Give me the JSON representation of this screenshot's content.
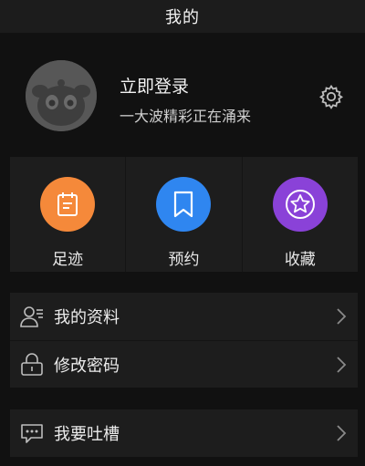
{
  "header": {
    "title": "我的"
  },
  "profile": {
    "name": "立即登录",
    "subtitle": "一大波精彩正在涌来"
  },
  "shortcuts": [
    {
      "label": "足迹",
      "icon": "notebook-icon",
      "color": "#f5893a"
    },
    {
      "label": "预约",
      "icon": "bookmark-icon",
      "color": "#2f86f0"
    },
    {
      "label": "收藏",
      "icon": "star-icon",
      "color": "#8a42d8"
    }
  ],
  "menu": {
    "profile_info": "我的资料",
    "change_password": "修改密码",
    "feedback": "我要吐槽"
  }
}
